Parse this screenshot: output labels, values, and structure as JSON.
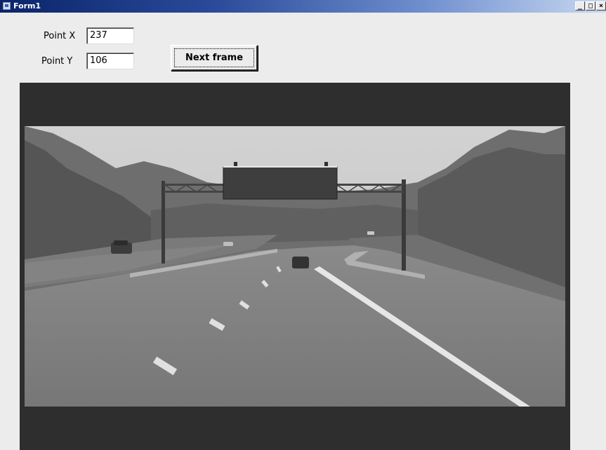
{
  "window": {
    "title": "Form1",
    "buttons": {
      "minimize": "_",
      "maximize": "□",
      "close": "×"
    }
  },
  "form": {
    "point_x_label": "Point X",
    "point_x_value": "237",
    "point_y_label": "Point Y",
    "point_y_value": "106",
    "next_button_label": "Next frame"
  },
  "video": {
    "content": "grayscale highway frame with overhead sign gantry"
  },
  "colors": {
    "titlebar_start": "#0a246a",
    "titlebar_end": "#c8d8f0",
    "form_background": "#ececec",
    "video_background": "#2e2e2e"
  }
}
